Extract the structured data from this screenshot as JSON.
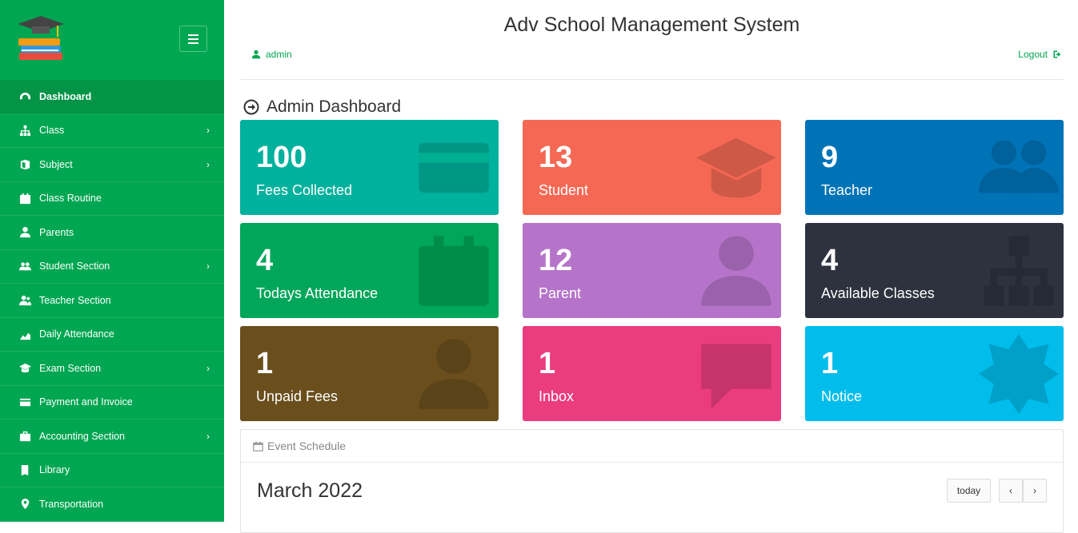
{
  "app": {
    "title": "Adv School Management System"
  },
  "header": {
    "user": "admin",
    "logout": "Logout"
  },
  "page": {
    "title": "Admin Dashboard"
  },
  "sidebar": {
    "items": [
      {
        "label": "Dashboard",
        "icon": "dashboard-icon",
        "chevron": false,
        "active": true
      },
      {
        "label": "Class",
        "icon": "sitemap-icon",
        "chevron": true
      },
      {
        "label": "Subject",
        "icon": "books-icon",
        "chevron": true
      },
      {
        "label": "Class Routine",
        "icon": "calendar-icon",
        "chevron": false
      },
      {
        "label": "Parents",
        "icon": "user-icon",
        "chevron": false
      },
      {
        "label": "Student Section",
        "icon": "users-icon",
        "chevron": true
      },
      {
        "label": "Teacher Section",
        "icon": "user-group-icon",
        "chevron": false
      },
      {
        "label": "Daily Attendance",
        "icon": "area-chart-icon",
        "chevron": false
      },
      {
        "label": "Exam Section",
        "icon": "graduation-cap-icon",
        "chevron": true
      },
      {
        "label": "Payment and Invoice",
        "icon": "credit-card-icon",
        "chevron": false
      },
      {
        "label": "Accounting Section",
        "icon": "briefcase-icon",
        "chevron": true
      },
      {
        "label": "Library",
        "icon": "book-icon",
        "chevron": false
      },
      {
        "label": "Transportation",
        "icon": "map-marker-icon",
        "chevron": false
      }
    ],
    "chevron_glyph": "›"
  },
  "tiles": [
    {
      "value": "100",
      "label": "Fees Collected",
      "color": "#00b19d",
      "icon": "credit-card-icon"
    },
    {
      "value": "13",
      "label": "Student",
      "color": "#f56954",
      "icon": "graduation-cap-icon"
    },
    {
      "value": "9",
      "label": "Teacher",
      "color": "#0073b7",
      "icon": "users-icon"
    },
    {
      "value": "4",
      "label": "Todays Attendance",
      "color": "#00a65a",
      "icon": "calendar-icon"
    },
    {
      "value": "12",
      "label": "Parent",
      "color": "#b574c9",
      "icon": "user-icon"
    },
    {
      "value": "4",
      "label": "Available Classes",
      "color": "#2d323e",
      "icon": "sitemap-icon"
    },
    {
      "value": "1",
      "label": "Unpaid Fees",
      "color": "#6a4f1d",
      "icon": "user-icon"
    },
    {
      "value": "1",
      "label": "Inbox",
      "color": "#ea3c7f",
      "icon": "comment-icon"
    },
    {
      "value": "1",
      "label": "Notice",
      "color": "#00bdec",
      "icon": "certificate-icon"
    }
  ],
  "calendar": {
    "panel_title": "Event Schedule",
    "month": "March 2022",
    "today_label": "today",
    "prev_label": "‹",
    "next_label": "›"
  },
  "colors": {
    "sidebar": "#00a651",
    "sidebar_active": "#039447",
    "accent": "#00a651"
  }
}
